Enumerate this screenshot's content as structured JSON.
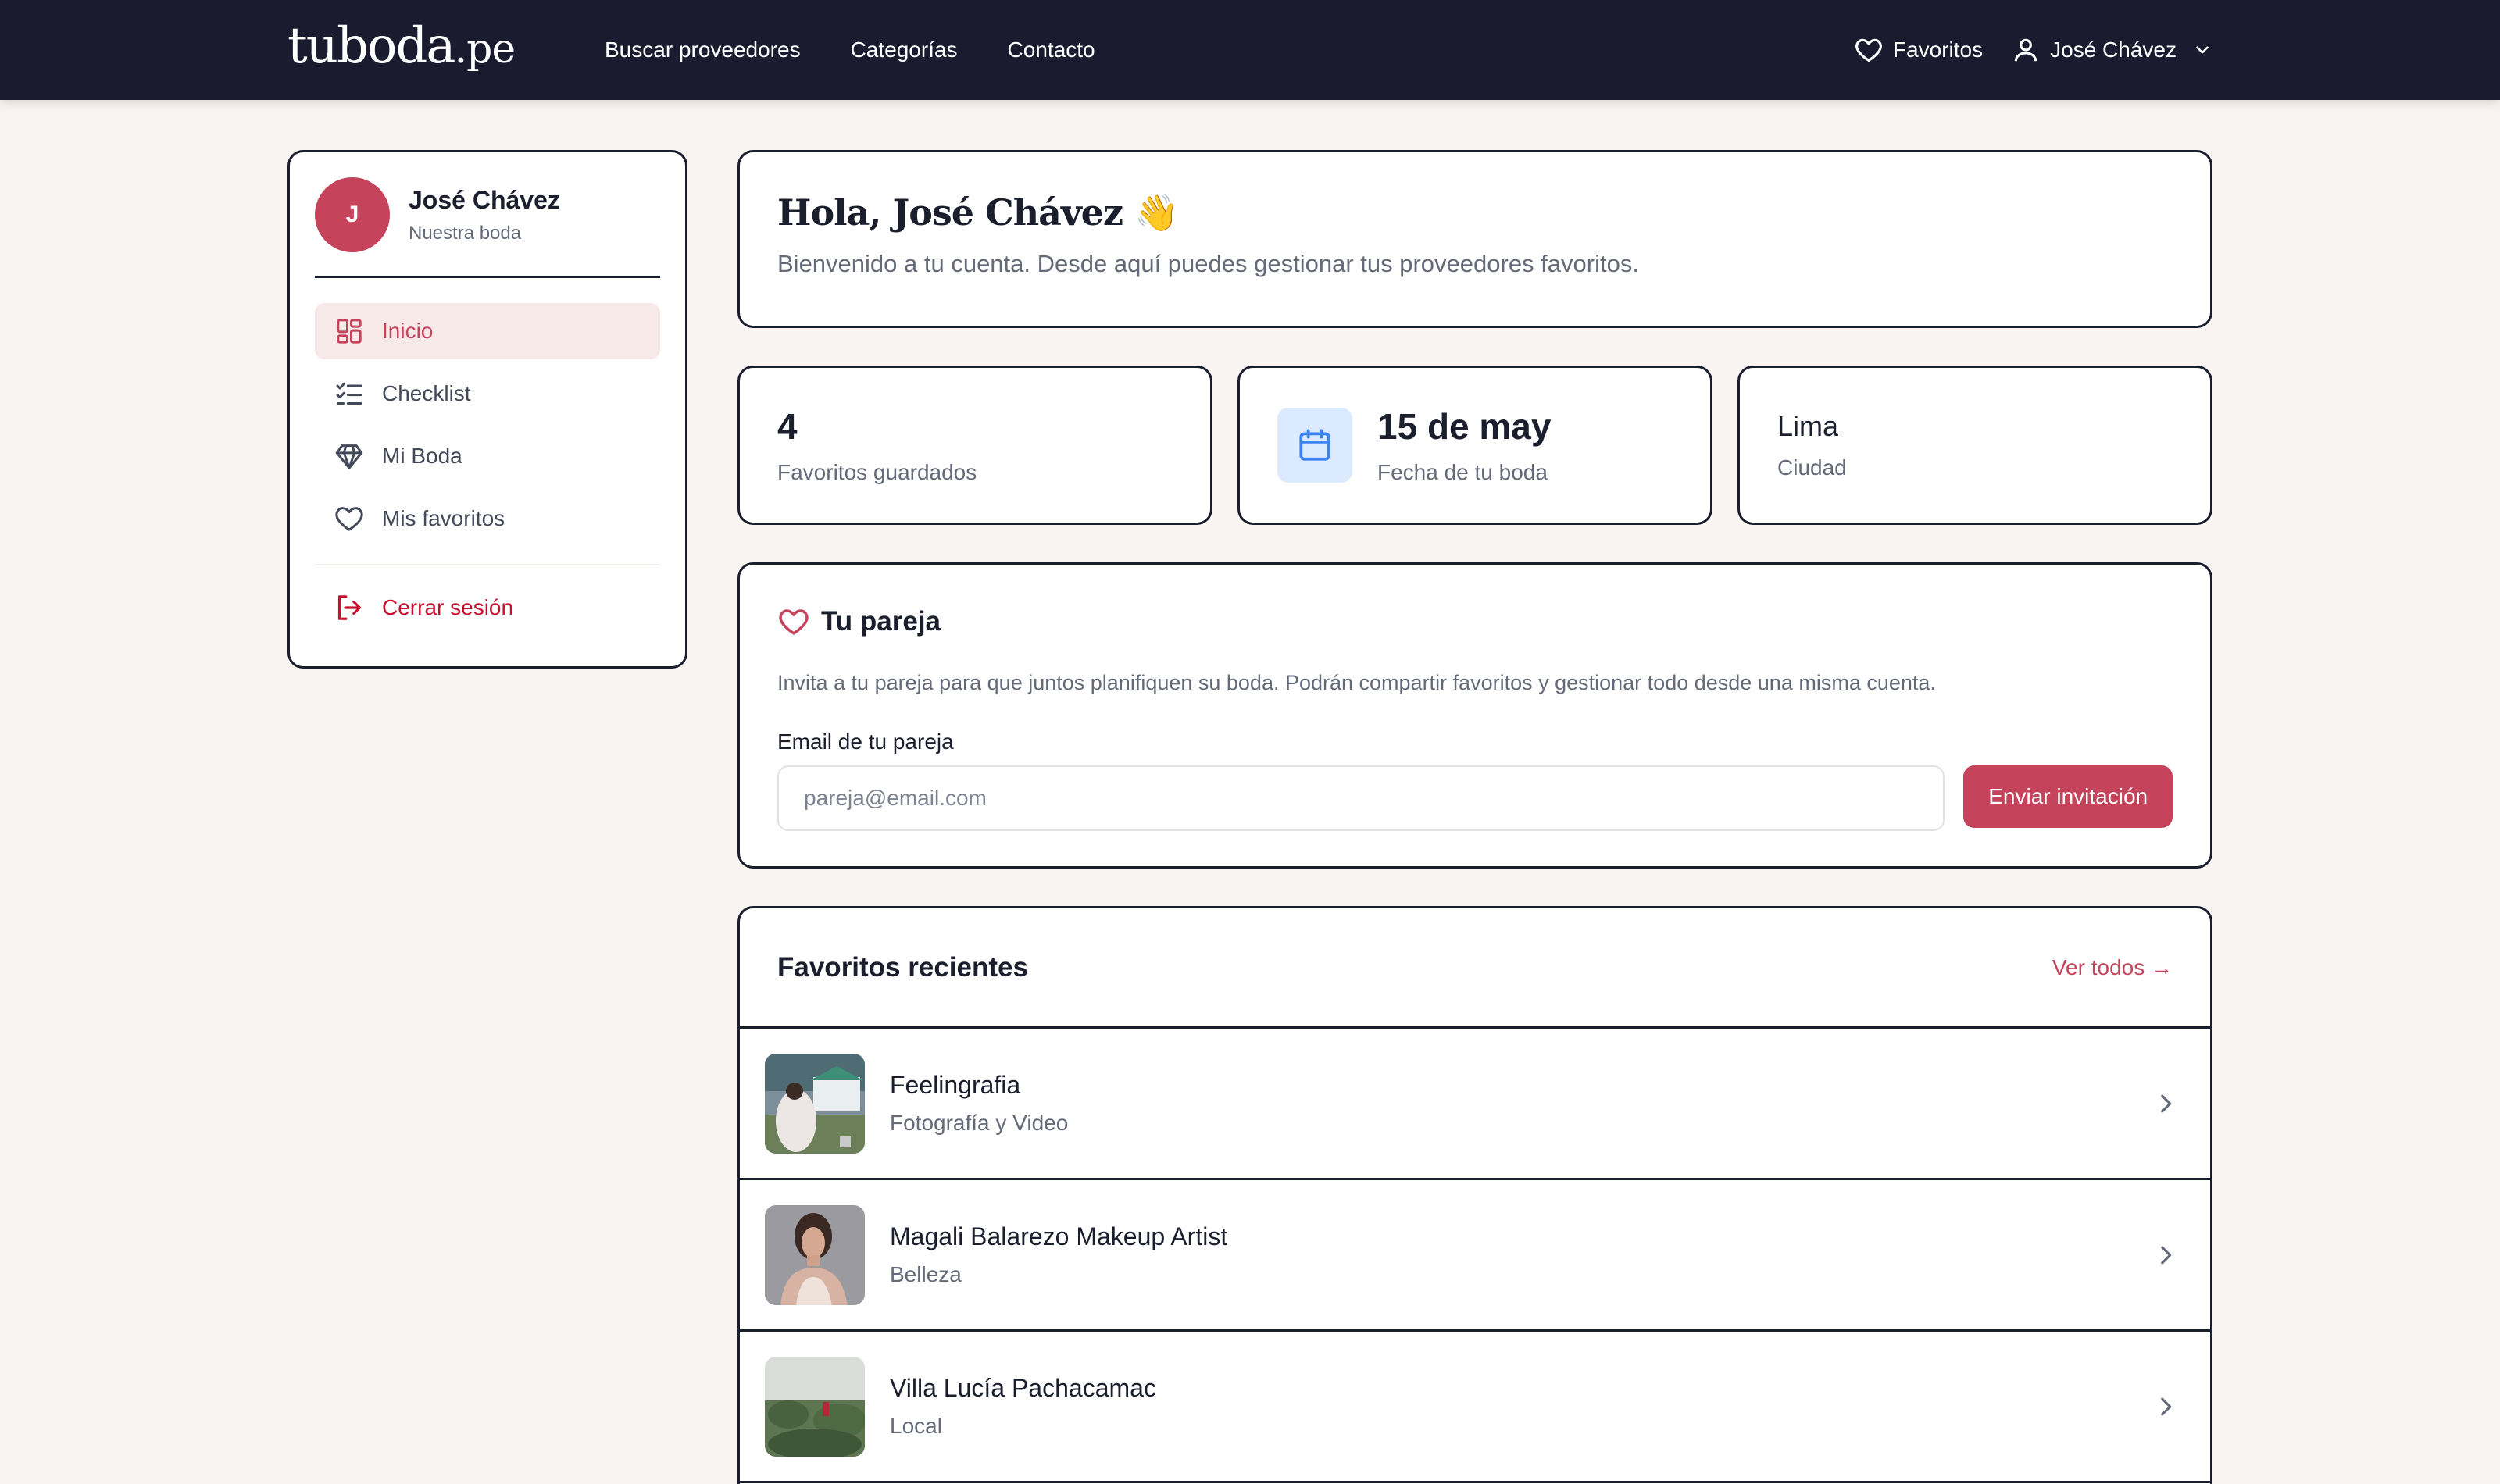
{
  "nav": {
    "logo_main": "tuboda",
    "logo_ext": ".pe",
    "links": [
      "Buscar proveedores",
      "Categorías",
      "Contacto"
    ],
    "favorites_label": "Favoritos",
    "user_label": "José Chávez"
  },
  "sidebar": {
    "avatar_initial": "J",
    "user_name": "José Chávez",
    "user_sub": "Nuestra boda",
    "items": [
      {
        "label": "Inicio",
        "icon": "dashboard-icon",
        "active": true
      },
      {
        "label": "Checklist",
        "icon": "checklist-icon",
        "active": false
      },
      {
        "label": "Mi Boda",
        "icon": "diamond-icon",
        "active": false
      },
      {
        "label": "Mis favoritos",
        "icon": "heart-icon",
        "active": false
      }
    ],
    "logout_label": "Cerrar sesión"
  },
  "welcome": {
    "title": "Hola, José Chávez 👋",
    "subtitle": "Bienvenido a tu cuenta. Desde aquí puedes gestionar tus proveedores favoritos."
  },
  "stats": [
    {
      "value": "4",
      "label": "Favoritos guardados"
    },
    {
      "value": "15 de may",
      "label": "Fecha de tu boda",
      "icon": "calendar-icon"
    },
    {
      "value": "Lima",
      "label": "Ciudad"
    }
  ],
  "partner": {
    "title": "Tu pareja",
    "description": "Invita a tu pareja para que juntos planifiquen su boda. Podrán compartir favoritos y gestionar todo desde una misma cuenta.",
    "email_label": "Email de tu pareja",
    "email_placeholder": "pareja@email.com",
    "email_value": "",
    "button_label": "Enviar invitación"
  },
  "favorites": {
    "title": "Favoritos recientes",
    "see_all": "Ver todos →",
    "items": [
      {
        "name": "Feelingrafia",
        "category": "Fotografía y Video"
      },
      {
        "name": "Magali Balarezo Makeup Artist",
        "category": "Belleza"
      },
      {
        "name": "Villa Lucía Pachacamac",
        "category": "Local"
      }
    ]
  },
  "colors": {
    "navbar": "#1a1b2e",
    "accent": "#c6435c",
    "background": "#f9f4f1",
    "border": "#1b1e2c",
    "muted_text": "#646a78",
    "calendar_bg": "#dbeafe",
    "calendar_icon": "#3b82f6",
    "logout": "#c8102e"
  }
}
